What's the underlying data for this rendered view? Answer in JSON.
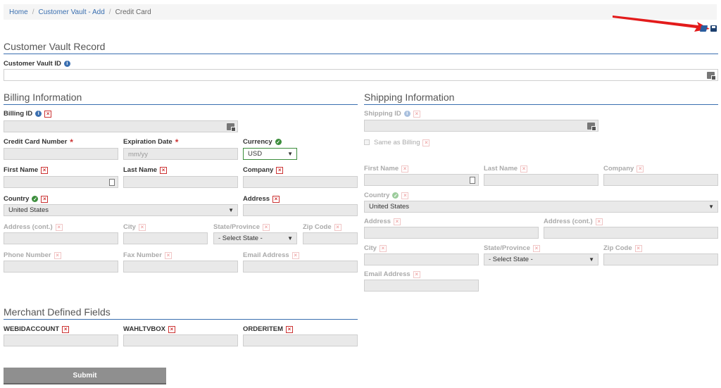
{
  "breadcrumb": {
    "home": "Home",
    "vault_add": "Customer Vault - Add",
    "current": "Credit Card"
  },
  "vault": {
    "title": "Customer Vault Record",
    "id_label": "Customer Vault ID"
  },
  "billing": {
    "title": "Billing Information",
    "billing_id": "Billing ID",
    "cc_number": "Credit Card Number",
    "exp_date": "Expiration Date",
    "exp_placeholder": "mm/yy",
    "currency": "Currency",
    "currency_value": "USD",
    "first_name": "First Name",
    "last_name": "Last Name",
    "company": "Company",
    "country": "Country",
    "country_value": "United States",
    "address": "Address",
    "address2": "Address (cont.)",
    "city": "City",
    "state": "State/Province",
    "state_value": "- Select State -",
    "zip": "Zip Code",
    "phone": "Phone Number",
    "fax": "Fax Number",
    "email": "Email Address"
  },
  "shipping": {
    "title": "Shipping Information",
    "shipping_id": "Shipping ID",
    "same_as_billing": "Same as Billing",
    "first_name": "First Name",
    "last_name": "Last Name",
    "company": "Company",
    "country": "Country",
    "country_value": "United States",
    "address": "Address",
    "address2": "Address (cont.)",
    "city": "City",
    "state": "State/Province",
    "state_value": "- Select State -",
    "zip": "Zip Code",
    "email": "Email Address"
  },
  "merchant": {
    "title": "Merchant Defined Fields",
    "f1": "WEBIDACCOUNT",
    "f2": "WAHLTVBOX",
    "f3": "ORDERITEM"
  },
  "submit_label": "Submit",
  "icons": {
    "x": "×",
    "star": "*",
    "info": "i",
    "check": "✓",
    "caret": "▼"
  },
  "colors": {
    "accent": "#3a6fb0",
    "error": "#cc3333",
    "success": "#3c8d3c",
    "arrow": "#e31b1b"
  }
}
